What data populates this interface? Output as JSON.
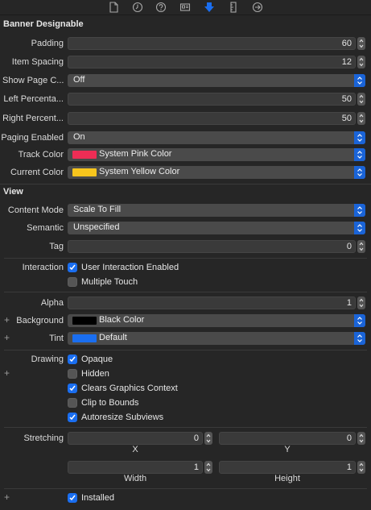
{
  "toolbar": {
    "icons": [
      "file-inspector-icon",
      "history-icon",
      "help-icon",
      "identity-icon",
      "attributes-icon",
      "size-icon",
      "connections-icon"
    ],
    "active": "attributes-icon",
    "accent": "#1a6ef0"
  },
  "banner": {
    "title": "Banner Designable",
    "padding_label": "Padding",
    "padding_value": "60",
    "item_spacing_label": "Item Spacing",
    "item_spacing_value": "12",
    "show_page_label": "Show Page C...",
    "show_page_value": "Off",
    "left_pct_label": "Left Percenta...",
    "left_pct_value": "50",
    "right_pct_label": "Right Percent...",
    "right_pct_value": "50",
    "paging_label": "Paging Enabled",
    "paging_value": "On",
    "track_color_label": "Track Color",
    "track_color_value": "System Pink Color",
    "track_color_hex": "#ee2d55",
    "current_color_label": "Current Color",
    "current_color_value": "System Yellow Color",
    "current_color_hex": "#f7c51d"
  },
  "view": {
    "title": "View",
    "content_mode_label": "Content Mode",
    "content_mode_value": "Scale To Fill",
    "semantic_label": "Semantic",
    "semantic_value": "Unspecified",
    "tag_label": "Tag",
    "tag_value": "0",
    "interaction_label": "Interaction",
    "user_interaction_label": "User Interaction Enabled",
    "user_interaction_checked": true,
    "multiple_touch_label": "Multiple Touch",
    "multiple_touch_checked": false,
    "alpha_label": "Alpha",
    "alpha_value": "1",
    "background_label": "Background",
    "background_value": "Black Color",
    "background_hex": "#000000",
    "tint_label": "Tint",
    "tint_value": "Default",
    "tint_hex": "#1a6ef0",
    "drawing_label": "Drawing",
    "opaque_label": "Opaque",
    "opaque_checked": true,
    "hidden_label": "Hidden",
    "hidden_checked": false,
    "clears_label": "Clears Graphics Context",
    "clears_checked": true,
    "clip_label": "Clip to Bounds",
    "clip_checked": false,
    "autoresize_label": "Autoresize Subviews",
    "autoresize_checked": true,
    "stretching_label": "Stretching",
    "stretch_x_value": "0",
    "stretch_x_label": "X",
    "stretch_y_value": "0",
    "stretch_y_label": "Y",
    "stretch_w_value": "1",
    "stretch_w_label": "Width",
    "stretch_h_value": "1",
    "stretch_h_label": "Height",
    "installed_label": "Installed",
    "installed_checked": true
  },
  "plus_symbol": "+"
}
